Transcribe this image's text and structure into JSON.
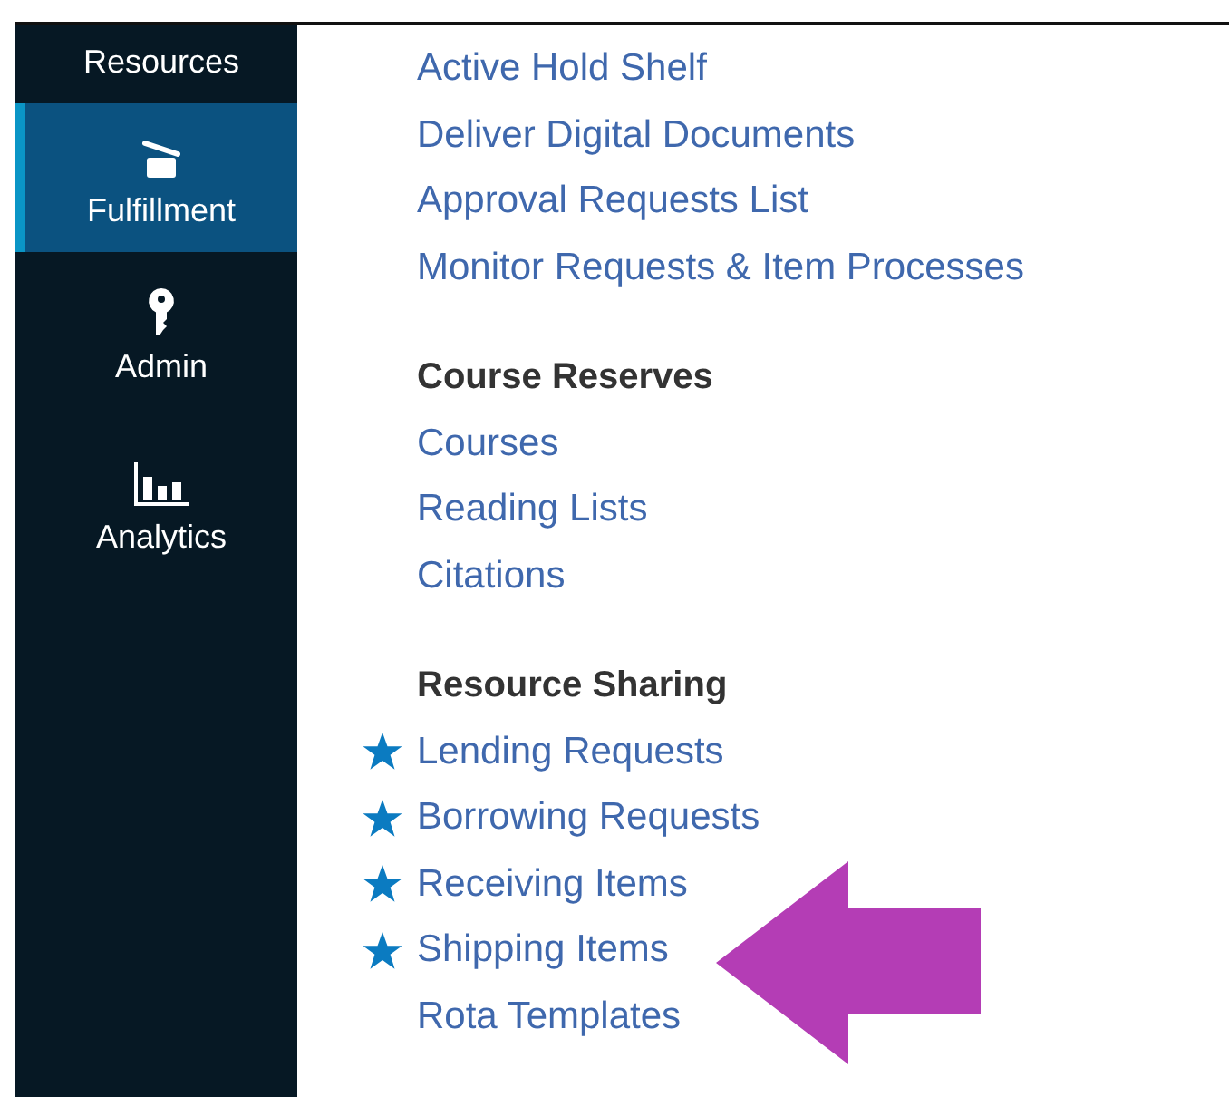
{
  "sidebar": {
    "items": [
      {
        "label": "Resources",
        "selected": false
      },
      {
        "label": "Fulfillment",
        "selected": true
      },
      {
        "label": "Admin",
        "selected": false
      },
      {
        "label": "Analytics",
        "selected": false
      }
    ]
  },
  "sections": [
    {
      "links": [
        {
          "label": "Active Hold Shelf",
          "starred": false
        },
        {
          "label": "Deliver Digital Documents",
          "starred": false
        },
        {
          "label": "Approval Requests List",
          "starred": false
        },
        {
          "label": "Monitor Requests & Item Processes",
          "starred": false
        }
      ]
    },
    {
      "heading": "Course Reserves",
      "links": [
        {
          "label": "Courses",
          "starred": false
        },
        {
          "label": "Reading Lists",
          "starred": false
        },
        {
          "label": "Citations",
          "starred": false
        }
      ]
    },
    {
      "heading": "Resource Sharing",
      "links": [
        {
          "label": "Lending Requests",
          "starred": true
        },
        {
          "label": "Borrowing Requests",
          "starred": true
        },
        {
          "label": "Receiving Items",
          "starred": true
        },
        {
          "label": "Shipping Items",
          "starred": true
        },
        {
          "label": "Rota Templates",
          "starred": false
        }
      ]
    }
  ]
}
